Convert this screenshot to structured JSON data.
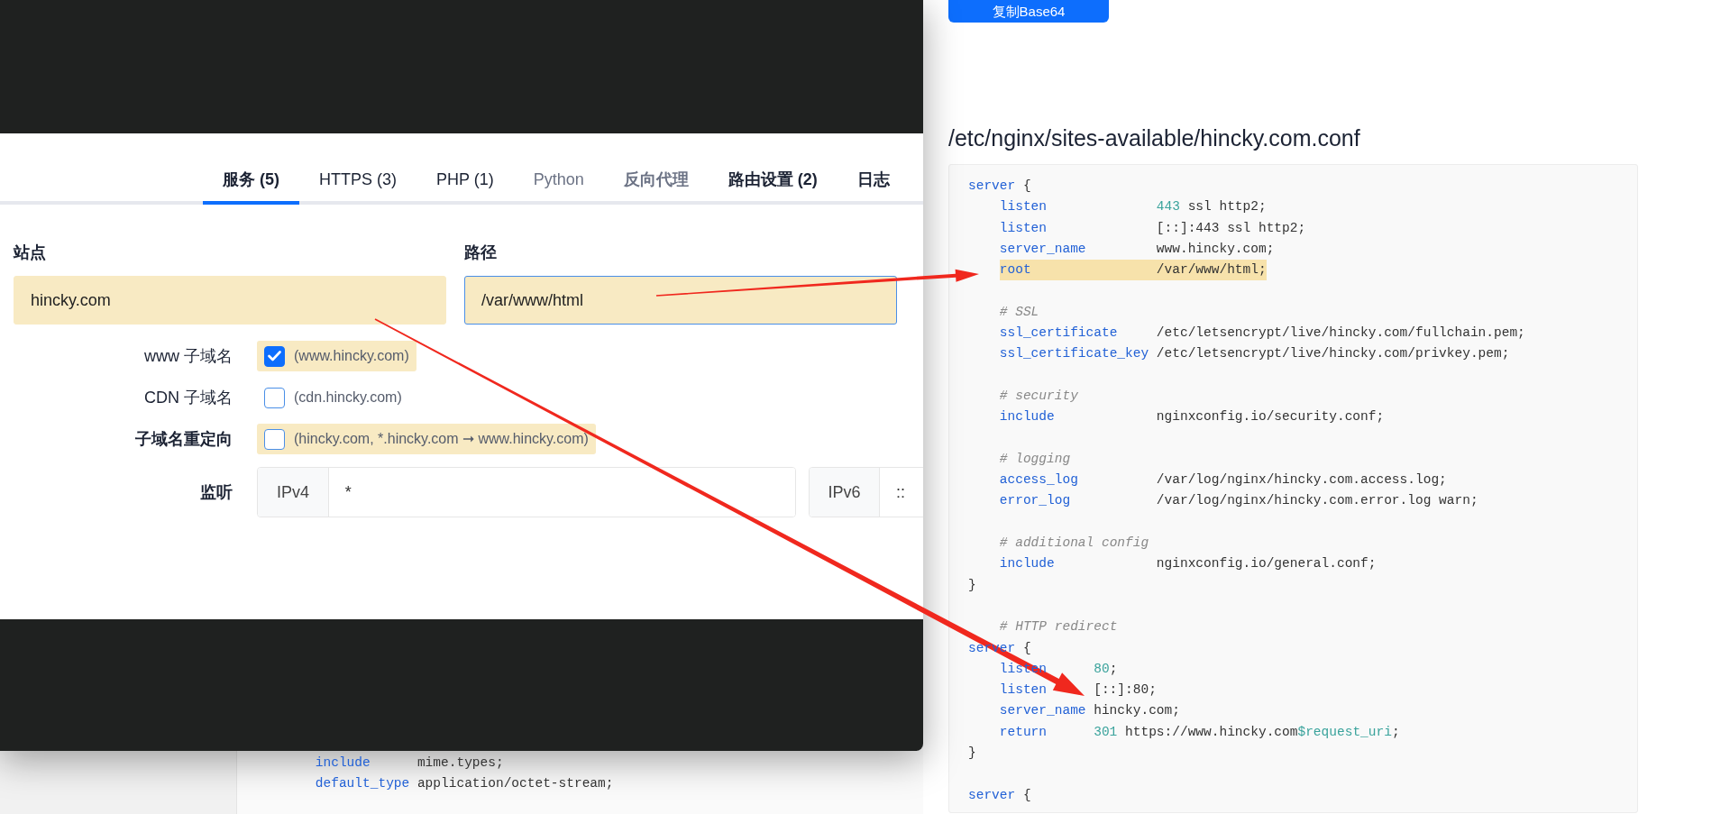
{
  "overlay": {
    "tabs": [
      {
        "label": "服务 (5)",
        "selected": true,
        "bold": true,
        "muted": false
      },
      {
        "label": "HTTPS (3)",
        "selected": false,
        "bold": false,
        "muted": false
      },
      {
        "label": "PHP (1)",
        "selected": false,
        "bold": false,
        "muted": false
      },
      {
        "label": "Python",
        "selected": false,
        "bold": false,
        "muted": true
      },
      {
        "label": "反向代理",
        "selected": false,
        "bold": true,
        "muted": true
      },
      {
        "label": "路由设置 (2)",
        "selected": false,
        "bold": true,
        "muted": false
      },
      {
        "label": "日志",
        "selected": false,
        "bold": true,
        "muted": false
      }
    ],
    "fields": [
      {
        "label": "站点",
        "value": "hincky.com",
        "highlighted": true,
        "focused": false
      },
      {
        "label": "路径",
        "value": "/var/www/html",
        "highlighted": true,
        "focused": true
      }
    ],
    "options": [
      {
        "label": "www 子域名",
        "label_bold": false,
        "checked": true,
        "highlighted": true,
        "hint": "(www.hincky.com)"
      },
      {
        "label": "CDN 子域名",
        "label_bold": false,
        "checked": false,
        "highlighted": false,
        "hint": "(cdn.hincky.com)"
      },
      {
        "label": "子域名重定向",
        "label_bold": true,
        "checked": false,
        "highlighted": true,
        "hint": "(hincky.com, *.hincky.com ➞ www.hincky.com)"
      }
    ],
    "listen": {
      "label": "监听",
      "groups": [
        {
          "prefix": "IPv4",
          "value": "*"
        },
        {
          "prefix": "IPv6",
          "value": "::"
        }
      ]
    }
  },
  "copy_button": {
    "label": "复制Base64"
  },
  "file_title": "/etc/nginx/sites-available/hincky.com.conf",
  "config_lines": [
    {
      "kind": "open",
      "text": "server",
      "suffix": " {"
    },
    {
      "kind": "directive",
      "key": "listen",
      "value": [
        {
          "kind": "number",
          "text": "443"
        },
        {
          "kind": "plain",
          "text": " ssl http2;"
        }
      ],
      "highlighted": false
    },
    {
      "kind": "directive",
      "key": "listen",
      "value": [
        {
          "kind": "plain",
          "text": "[::]:443 ssl http2;"
        }
      ],
      "highlighted": false
    },
    {
      "kind": "directive",
      "key": "server_name",
      "value": [
        {
          "kind": "plain",
          "text": "www.hincky.com;"
        }
      ],
      "highlighted": false
    },
    {
      "kind": "directive",
      "key": "root",
      "value": [
        {
          "kind": "plain",
          "text": "/var/www/html;"
        }
      ],
      "highlighted": true
    },
    {
      "kind": "blank"
    },
    {
      "kind": "comment",
      "text": "# SSL"
    },
    {
      "kind": "directive",
      "key": "ssl_certificate",
      "value": [
        {
          "kind": "plain",
          "text": "/etc/letsencrypt/live/hincky.com/fullchain.pem;"
        }
      ],
      "highlighted": false
    },
    {
      "kind": "directive",
      "key": "ssl_certificate_key",
      "value": [
        {
          "kind": "plain",
          "text": "/etc/letsencrypt/live/hincky.com/privkey.pem;"
        }
      ],
      "highlighted": false
    },
    {
      "kind": "blank"
    },
    {
      "kind": "comment",
      "text": "# security"
    },
    {
      "kind": "directive",
      "key": "include",
      "value": [
        {
          "kind": "plain",
          "text": "nginxconfig.io/security.conf;"
        }
      ],
      "highlighted": false
    },
    {
      "kind": "blank"
    },
    {
      "kind": "comment",
      "text": "# logging"
    },
    {
      "kind": "directive",
      "key": "access_log",
      "value": [
        {
          "kind": "plain",
          "text": "/var/log/nginx/hincky.com.access.log;"
        }
      ],
      "highlighted": false
    },
    {
      "kind": "directive",
      "key": "error_log",
      "value": [
        {
          "kind": "plain",
          "text": "/var/log/nginx/hincky.com.error.log warn;"
        }
      ],
      "highlighted": false
    },
    {
      "kind": "blank"
    },
    {
      "kind": "comment",
      "text": "# additional config"
    },
    {
      "kind": "directive",
      "key": "include",
      "value": [
        {
          "kind": "plain",
          "text": "nginxconfig.io/general.conf;"
        }
      ],
      "highlighted": false
    },
    {
      "kind": "close",
      "text": "}"
    },
    {
      "kind": "blank"
    },
    {
      "kind": "comment",
      "text": "# HTTP redirect"
    },
    {
      "kind": "open",
      "text": "server",
      "suffix": " {"
    },
    {
      "kind": "directive",
      "key": "listen",
      "value": [
        {
          "kind": "number",
          "text": "80"
        },
        {
          "kind": "plain",
          "text": ";"
        }
      ],
      "highlighted": false
    },
    {
      "kind": "directive",
      "key": "listen",
      "value": [
        {
          "kind": "plain",
          "text": "[::]:80;"
        }
      ],
      "highlighted": false
    },
    {
      "kind": "directive",
      "key": "server_name",
      "value": [
        {
          "kind": "plain",
          "text": "hincky.com;"
        }
      ],
      "highlighted": false
    },
    {
      "kind": "directive",
      "key": "return",
      "value": [
        {
          "kind": "number",
          "text": "301"
        },
        {
          "kind": "plain",
          "text": " https://www.hincky.com"
        },
        {
          "kind": "number",
          "text": "$request_uri"
        },
        {
          "kind": "plain",
          "text": ";"
        }
      ],
      "highlighted": false
    },
    {
      "kind": "close",
      "text": "}"
    },
    {
      "kind": "blank"
    },
    {
      "kind": "open",
      "text": "server",
      "suffix": " {"
    }
  ],
  "background_lines": [
    {
      "kind": "directive",
      "key": "include",
      "value": [
        {
          "kind": "plain",
          "text": "mime.types;"
        }
      ],
      "highlighted": false
    },
    {
      "kind": "directive",
      "key": "default_type",
      "value": [
        {
          "kind": "plain",
          "text": "application/octet-stream;"
        }
      ],
      "highlighted": false
    }
  ]
}
